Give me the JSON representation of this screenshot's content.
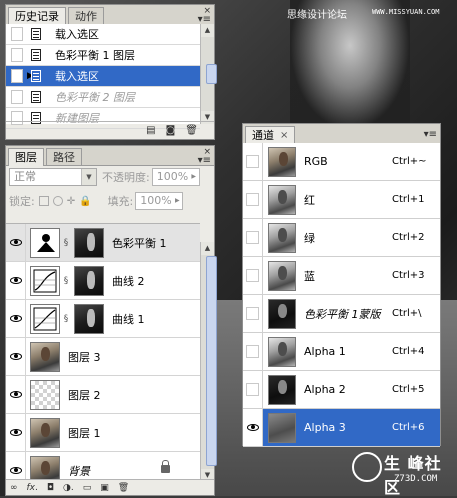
{
  "watermark": {
    "text": "思缘设计论坛",
    "url": "WWW.MISSYUAN.COM"
  },
  "logo": {
    "text": "生 峰社区",
    "sub": "Z73D.COM"
  },
  "history_panel": {
    "tabs": [
      {
        "label": "历史记录"
      },
      {
        "label": "动作"
      }
    ],
    "items": [
      {
        "label": "载入选区"
      },
      {
        "label": "色彩平衡 1 图层"
      },
      {
        "label": "载入选区"
      },
      {
        "label": "色彩平衡 2 图层"
      },
      {
        "label": "新建图层"
      }
    ]
  },
  "layers_panel": {
    "tabs": [
      {
        "label": "图层"
      },
      {
        "label": "路径"
      }
    ],
    "blend_mode": "正常",
    "opacity_label": "不透明度:",
    "opacity_value": "100%",
    "lock_label": "锁定:",
    "fill_label": "填充:",
    "fill_value": "100%",
    "layers": [
      {
        "name": "色彩平衡 1"
      },
      {
        "name": "曲线 2"
      },
      {
        "name": "曲线 1"
      },
      {
        "name": "图层 3"
      },
      {
        "name": "图层 2"
      },
      {
        "name": "图层 1"
      },
      {
        "name": "背景"
      }
    ],
    "footer_icons": [
      "link-icon",
      "fx-icon",
      "mask-icon",
      "adjustment-icon",
      "group-icon",
      "new-layer-icon",
      "trash-icon"
    ]
  },
  "channels_panel": {
    "tabs": [
      {
        "label": "通道"
      }
    ],
    "channels": [
      {
        "name": "RGB",
        "shortcut": "Ctrl+~"
      },
      {
        "name": "红",
        "shortcut": "Ctrl+1"
      },
      {
        "name": "绿",
        "shortcut": "Ctrl+2"
      },
      {
        "name": "蓝",
        "shortcut": "Ctrl+3"
      },
      {
        "name": "色彩平衡 1蒙版",
        "shortcut": "Ctrl+\\"
      },
      {
        "name": "Alpha 1",
        "shortcut": "Ctrl+4"
      },
      {
        "name": "Alpha 2",
        "shortcut": "Ctrl+5"
      },
      {
        "name": "Alpha 3",
        "shortcut": "Ctrl+6"
      }
    ]
  },
  "colors": {
    "selection": "#3169c6",
    "panel_bg": "#ecebe6"
  }
}
